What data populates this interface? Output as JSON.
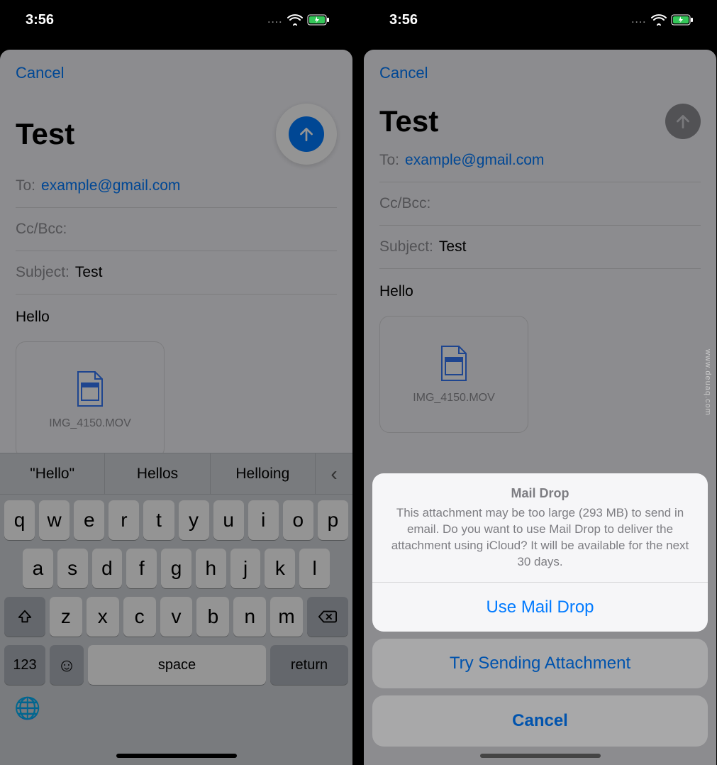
{
  "status": {
    "time": "3:56",
    "dots": "....",
    "wifi_label": "wifi",
    "battery_label": "charging"
  },
  "compose": {
    "cancel": "Cancel",
    "title": "Test",
    "to_label": "To:",
    "to_value": "example@gmail.com",
    "ccbcc_label": "Cc/Bcc:",
    "subject_label": "Subject:",
    "subject_value": "Test",
    "body": "Hello",
    "attachment_name": "IMG_4150.MOV"
  },
  "keyboard": {
    "suggestions": [
      "\"Hello\"",
      "Hellos",
      "Helloing"
    ],
    "row1": [
      "q",
      "w",
      "e",
      "r",
      "t",
      "y",
      "u",
      "i",
      "o",
      "p"
    ],
    "row2": [
      "a",
      "s",
      "d",
      "f",
      "g",
      "h",
      "j",
      "k",
      "l"
    ],
    "row3": [
      "z",
      "x",
      "c",
      "v",
      "b",
      "n",
      "m"
    ],
    "numkey": "123",
    "space": "space",
    "return": "return"
  },
  "maildrop": {
    "title": "Mail Drop",
    "desc": "This attachment may be too large (293 MB) to send in email. Do you want to use Mail Drop to deliver the attachment using iCloud? It will be available for the next 30 days.",
    "use": "Use Mail Drop",
    "try": "Try Sending Attachment",
    "cancel": "Cancel"
  },
  "watermark": "www.deuaq.com"
}
